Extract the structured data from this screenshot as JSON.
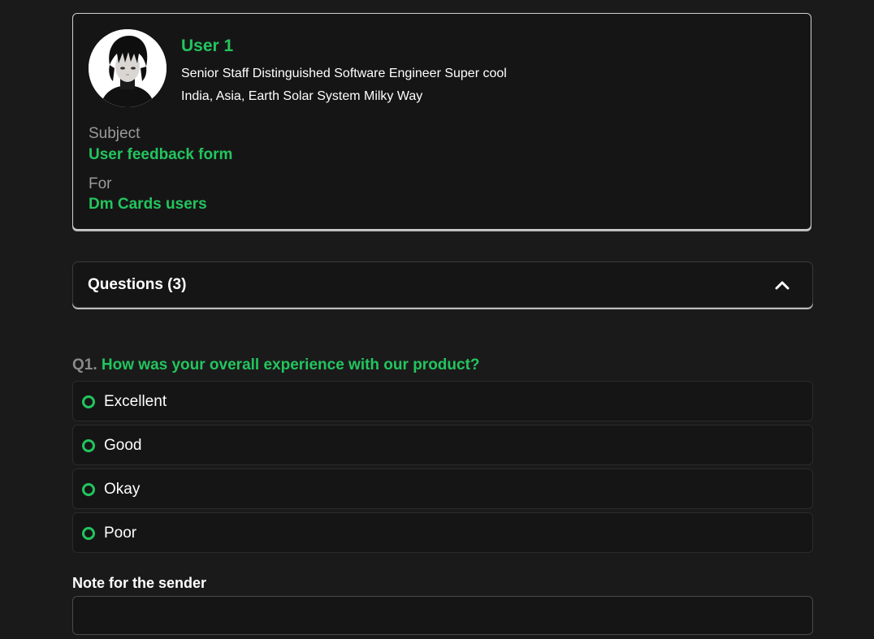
{
  "profile": {
    "name": "User 1",
    "title": "Senior Staff Distinguished Software Engineer Super cool",
    "location": "India, Asia, Earth Solar System Milky Way",
    "avatar": "anime-character-avatar",
    "subject_label": "Subject",
    "subject_value": "User feedback form",
    "for_label": "For",
    "for_value": "Dm Cards users"
  },
  "questions_section": {
    "title": "Questions (3)",
    "toggle_icon": "chevron-up-icon",
    "expanded": true
  },
  "question1": {
    "number": "Q1.",
    "text": "How was your overall experience with our product?",
    "options": [
      "Excellent",
      "Good",
      "Okay",
      "Poor"
    ]
  },
  "note": {
    "label": "Note for the sender",
    "value": "",
    "placeholder": ""
  },
  "colors": {
    "accent": "#22c55e",
    "background": "#1b1a1b",
    "card": "#161516",
    "muted": "#9a9a9a"
  }
}
